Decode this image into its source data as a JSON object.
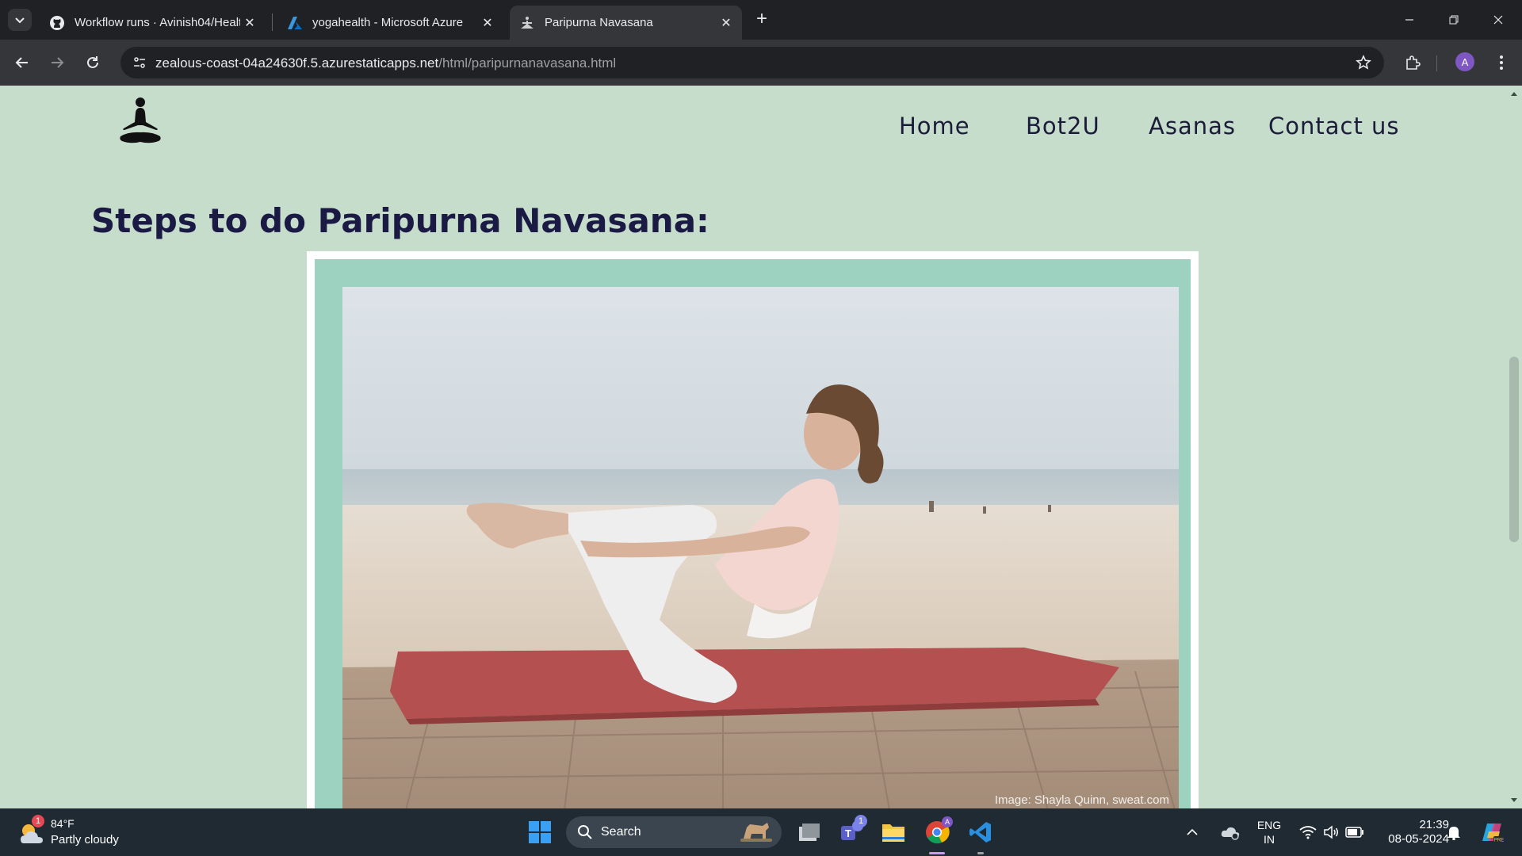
{
  "browser": {
    "tabs": [
      {
        "title": "Workflow runs · Avinish04/Healt",
        "icon": "github-icon",
        "active": false
      },
      {
        "title": "yogahealth - Microsoft Azure",
        "icon": "azure-icon",
        "active": false
      },
      {
        "title": "Paripurna Navasana",
        "icon": "yoga-favicon",
        "active": true
      }
    ],
    "url_host": "zealous-coast-04a24630f.5.azurestaticapps.net",
    "url_path": "/html/paripurnanavasana.html",
    "profile_initial": "A"
  },
  "page": {
    "nav": {
      "home": "Home",
      "bot": "Bot2U",
      "asanas": "Asanas",
      "contact": "Contact us"
    },
    "heading": "Steps to do Paripurna Navasana:",
    "image_credit": "Image: Shayla Quinn, sweat.com",
    "colors": {
      "background": "#c6ddcc",
      "frame_inner": "#9ed2c0",
      "heading": "#1a1a44"
    }
  },
  "taskbar": {
    "weather_temp": "84°F",
    "weather_condition": "Partly cloudy",
    "weather_badge": "1",
    "search_label": "Search",
    "teams_badge": "1",
    "lang_top": "ENG",
    "lang_bottom": "IN",
    "time": "21:39",
    "date": "08-05-2024"
  }
}
